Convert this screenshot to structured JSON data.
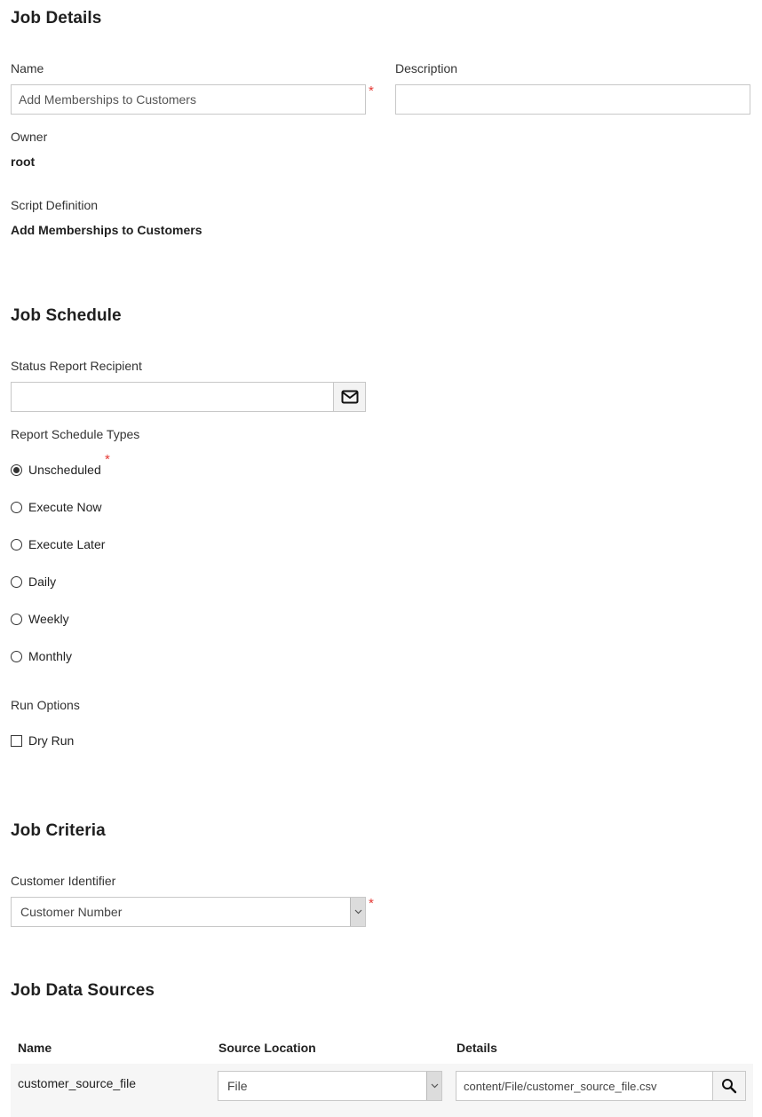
{
  "job_details": {
    "title": "Job Details",
    "name_label": "Name",
    "name_value": "Add Memberships to Customers",
    "name_required": "*",
    "description_label": "Description",
    "description_value": "",
    "owner_label": "Owner",
    "owner_value": "root",
    "script_definition_label": "Script Definition",
    "script_definition_value": "Add Memberships to Customers"
  },
  "job_schedule": {
    "title": "Job Schedule",
    "status_report_recipient_label": "Status Report Recipient",
    "status_report_recipient_value": "",
    "report_schedule_types_label": "Report Schedule Types",
    "schedule_required": "*",
    "schedule_options": [
      {
        "label": "Unscheduled",
        "checked": true
      },
      {
        "label": "Execute Now",
        "checked": false
      },
      {
        "label": "Execute Later",
        "checked": false
      },
      {
        "label": "Daily",
        "checked": false
      },
      {
        "label": "Weekly",
        "checked": false
      },
      {
        "label": "Monthly",
        "checked": false
      }
    ],
    "run_options_label": "Run Options",
    "dry_run_label": "Dry Run",
    "dry_run_checked": false
  },
  "job_criteria": {
    "title": "Job Criteria",
    "customer_identifier_label": "Customer Identifier",
    "customer_identifier_value": "Customer Number",
    "customer_identifier_required": "*"
  },
  "job_data_sources": {
    "title": "Job Data Sources",
    "columns": [
      "Name",
      "Source Location",
      "Details"
    ],
    "rows": [
      {
        "name": "customer_source_file",
        "source_location": "File",
        "details": "content/File/customer_source_file.csv"
      }
    ]
  },
  "icons": {
    "email": "envelope-icon",
    "search": "magnifier-icon",
    "dropdown": "chevron-down-icon"
  },
  "colors": {
    "required": "#e53935",
    "row_background": "#f6f6f6",
    "input_border": "#c8c8c8"
  }
}
